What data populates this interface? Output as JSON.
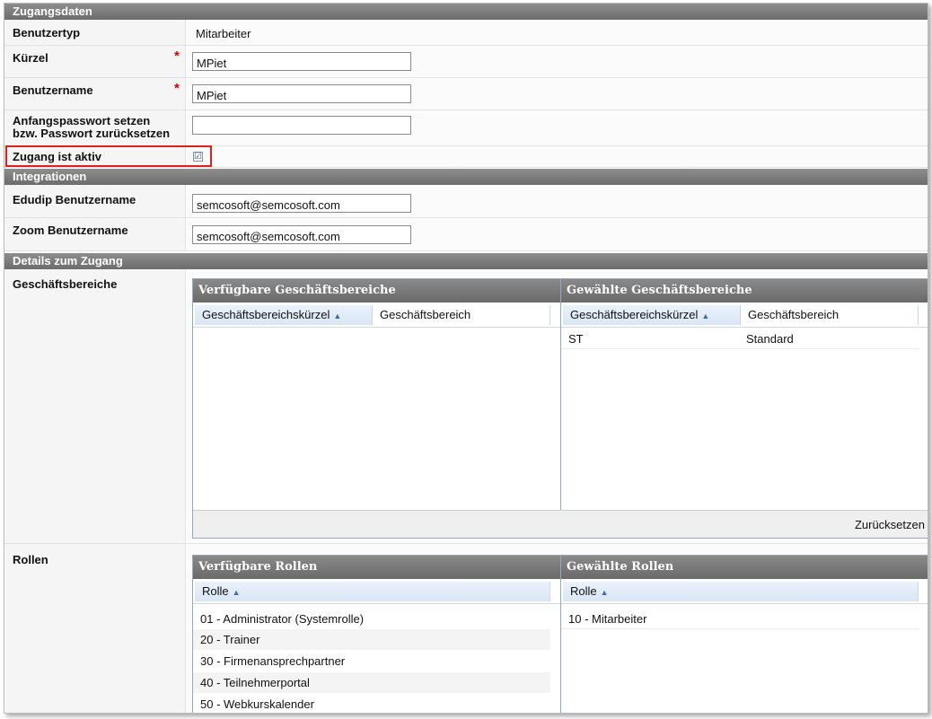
{
  "sections": {
    "zugangsdaten": "Zugangsdaten",
    "integrationen": "Integrationen",
    "details": "Details zum Zugang"
  },
  "fields": {
    "benutzertyp": {
      "label": "Benutzertyp",
      "value": "Mitarbeiter"
    },
    "kuerzel": {
      "label": "Kürzel",
      "value": "MPiet",
      "required_mark": "*"
    },
    "benutzername": {
      "label": "Benutzername",
      "value": "MPiet",
      "required_mark": "*"
    },
    "passwort": {
      "label_line1": "Anfangspasswort setzen",
      "label_line2": "bzw. Passwort zurücksetzen",
      "value": ""
    },
    "zugang_aktiv": {
      "label": "Zugang ist aktiv",
      "checked": true,
      "check_glyph": "☑"
    },
    "edudip": {
      "label": "Edudip Benutzername",
      "value": "semcosoft@semcosoft.com"
    },
    "zoom": {
      "label": "Zoom Benutzername",
      "value": "semcosoft@semcosoft.com"
    }
  },
  "geschaeftsbereiche": {
    "label": "Geschäftsbereiche",
    "available": {
      "title": "Verfügbare Geschäftsbereiche",
      "columns": [
        "Geschäftsbereichskürzel",
        "Geschäftsbereich"
      ],
      "sort_arrow": "▲",
      "rows": []
    },
    "selected": {
      "title": "Gewählte Geschäftsbereiche",
      "columns": [
        "Geschäftsbereichskürzel",
        "Geschäftsbereich"
      ],
      "sort_arrow": "▲",
      "rows": [
        {
          "kuerzel": "ST",
          "bereich": "Standard"
        }
      ]
    },
    "reset_label": "Zurücksetzen"
  },
  "rollen": {
    "label": "Rollen",
    "available": {
      "title": "Verfügbare Rollen",
      "column": "Rolle",
      "sort_arrow": "▲",
      "rows": [
        "01 - Administrator (Systemrolle)",
        "20 - Trainer",
        "30 - Firmenansprechpartner",
        "40 - Teilnehmerportal",
        "50 - Webkurskalender"
      ]
    },
    "selected": {
      "title": "Gewählte Rollen",
      "column": "Rolle",
      "sort_arrow": "▲",
      "rows": [
        "10 - Mitarbeiter"
      ]
    }
  },
  "colors": {
    "section_header": "#7a7a7a",
    "required": "#d40000",
    "highlight_border": "#e02020",
    "sorted_header": "#d9e6f5"
  }
}
